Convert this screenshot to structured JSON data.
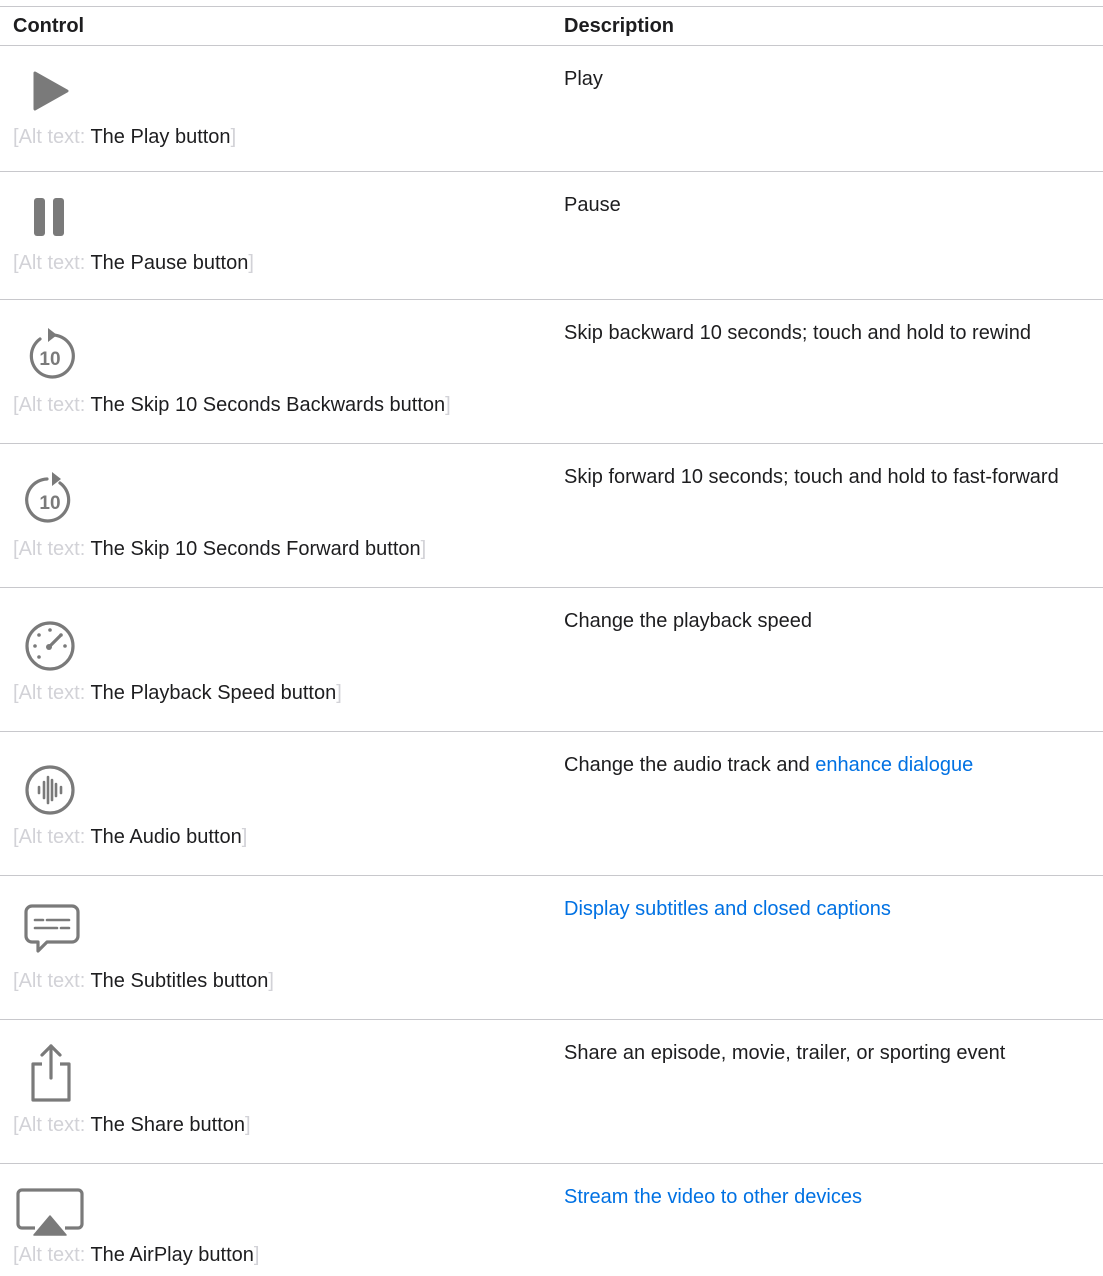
{
  "table": {
    "headers": {
      "control": "Control",
      "description": "Description"
    },
    "alt_label": "Alt text:",
    "rows": [
      {
        "icon": "play-icon",
        "alt_name": "The Play button",
        "desc": "Play",
        "desc_link": ""
      },
      {
        "icon": "pause-icon",
        "alt_name": "The Pause button",
        "desc": "Pause",
        "desc_link": ""
      },
      {
        "icon": "skip-back-10-icon",
        "icon_text": "10",
        "alt_name": "The Skip 10 Seconds Backwards button",
        "desc": "Skip backward 10 seconds; touch and hold to rewind",
        "desc_link": ""
      },
      {
        "icon": "skip-forward-10-icon",
        "icon_text": "10",
        "alt_name": "The Skip 10 Seconds Forward button",
        "desc": "Skip forward 10 seconds; touch and hold to fast-forward",
        "desc_link": ""
      },
      {
        "icon": "playback-speed-icon",
        "alt_name": "The Playback Speed button",
        "desc": "Change the playback speed",
        "desc_link": ""
      },
      {
        "icon": "audio-waveform-icon",
        "alt_name": "The Audio button",
        "desc": "Change the audio track and ",
        "desc_link": "enhance dialogue"
      },
      {
        "icon": "subtitles-icon",
        "alt_name": "The Subtitles button",
        "desc": "",
        "desc_link": "Display subtitles and closed captions"
      },
      {
        "icon": "share-icon",
        "alt_name": "The Share button",
        "desc": "Share an episode, movie, trailer, or sporting event",
        "desc_link": ""
      },
      {
        "icon": "airplay-icon",
        "alt_name": "The AirPlay button",
        "desc": "",
        "desc_link": "Stream the video to other devices"
      }
    ]
  },
  "colors": {
    "icon": "#7a7a7a",
    "link": "#0071e3",
    "alt_label": "#d2d2d7",
    "divider": "#c8c8cc"
  }
}
